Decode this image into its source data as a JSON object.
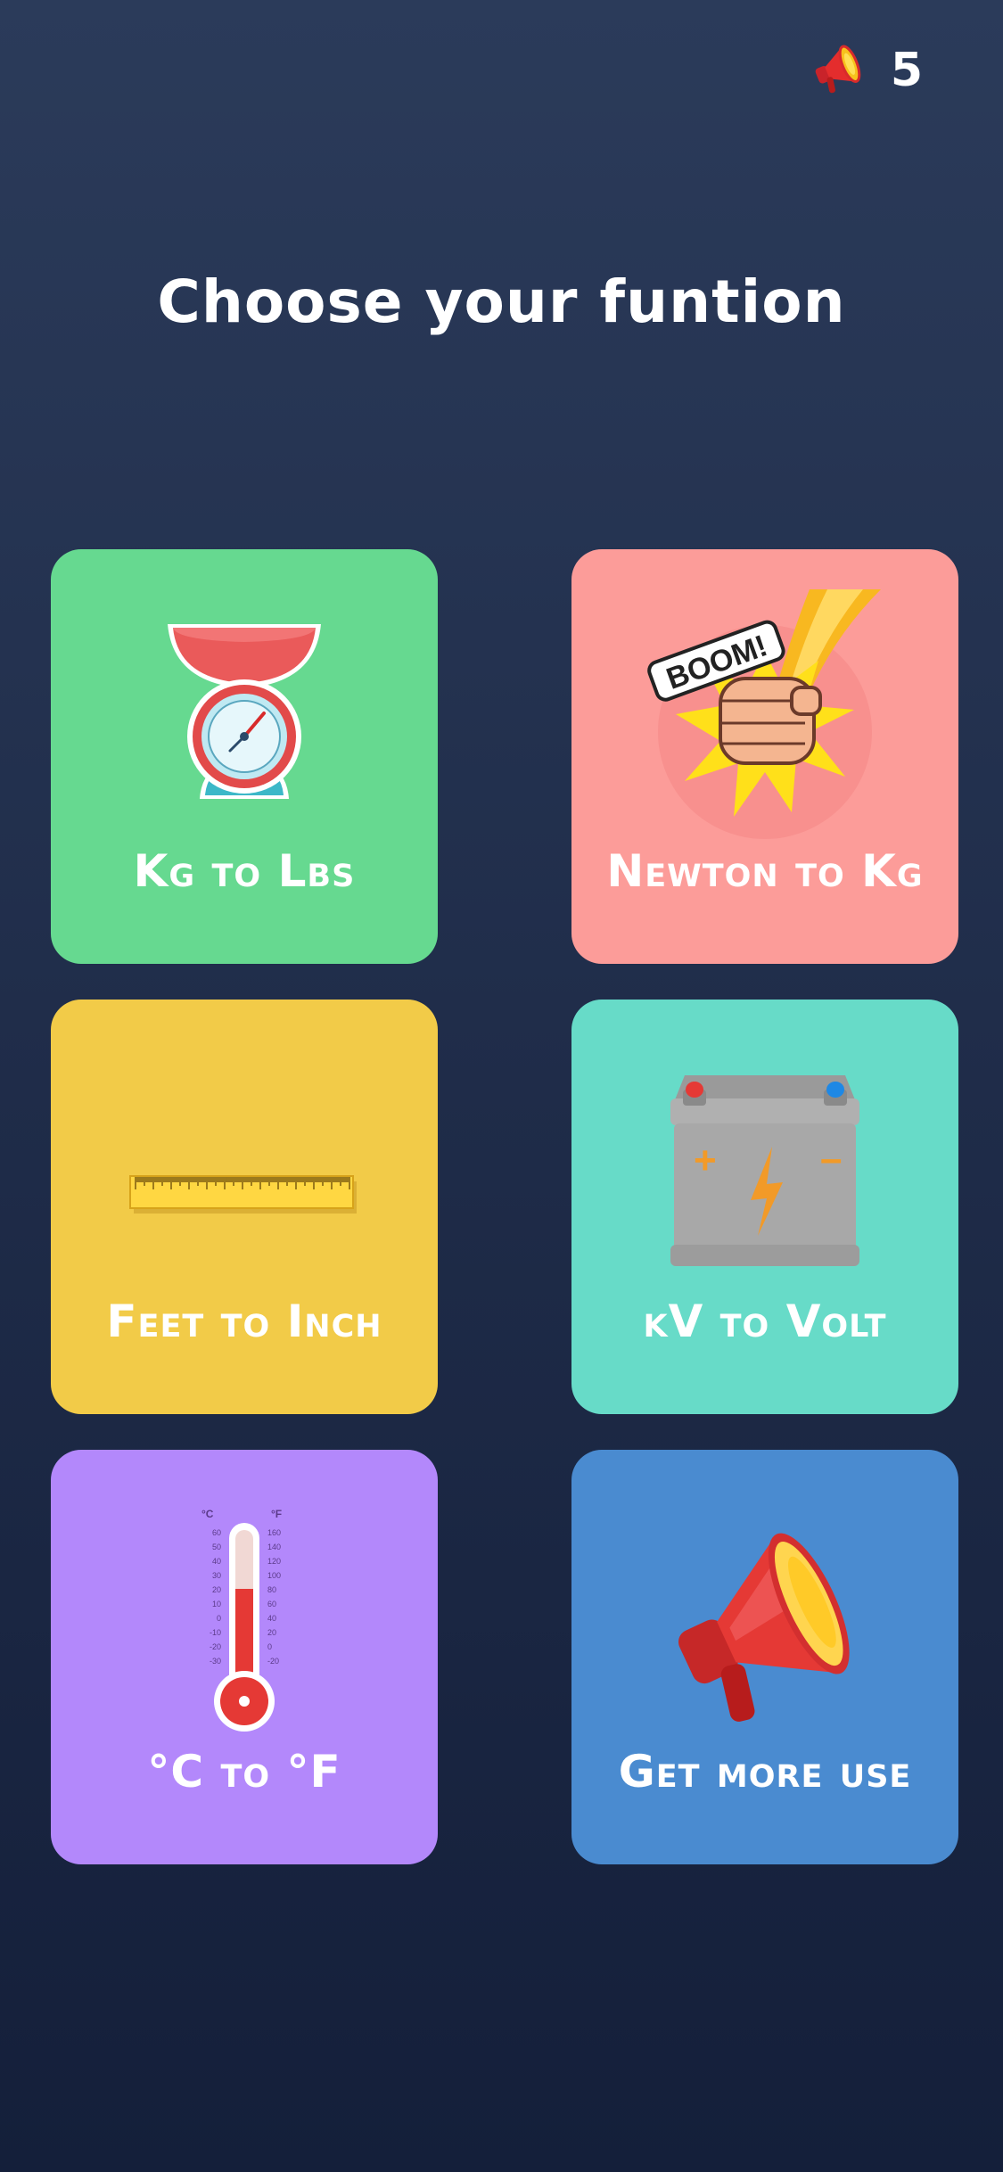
{
  "header": {
    "credit_icon": "megaphone-icon",
    "credit_count": "5"
  },
  "title": "Choose your funtion",
  "cards": [
    {
      "label": "Kg to Lbs",
      "icon": "scale-icon",
      "color": "#66d990"
    },
    {
      "label": "Newton to Kg",
      "icon": "fist-boom-icon",
      "color": "#fc9c99"
    },
    {
      "label": "Feet to Inch",
      "icon": "ruler-icon",
      "color": "#f2cb48"
    },
    {
      "label": "kV to Volt",
      "icon": "battery-icon",
      "color": "#67dbc8"
    },
    {
      "label": "°C to °F",
      "icon": "thermometer-icon",
      "color": "#b388fb"
    },
    {
      "label": "Get more use",
      "icon": "megaphone-icon",
      "color": "#4a8bd0"
    }
  ],
  "thermometer": {
    "celsius_unit": "°C",
    "fahrenheit_unit": "°F",
    "celsius_ticks": [
      "60",
      "50",
      "40",
      "30",
      "20",
      "10",
      "0",
      "-10",
      "-20",
      "-30"
    ],
    "fahrenheit_ticks": [
      "160",
      "140",
      "120",
      "100",
      "80",
      "60",
      "40",
      "20",
      "0",
      "-20"
    ]
  },
  "boom_text": "BOOM!"
}
